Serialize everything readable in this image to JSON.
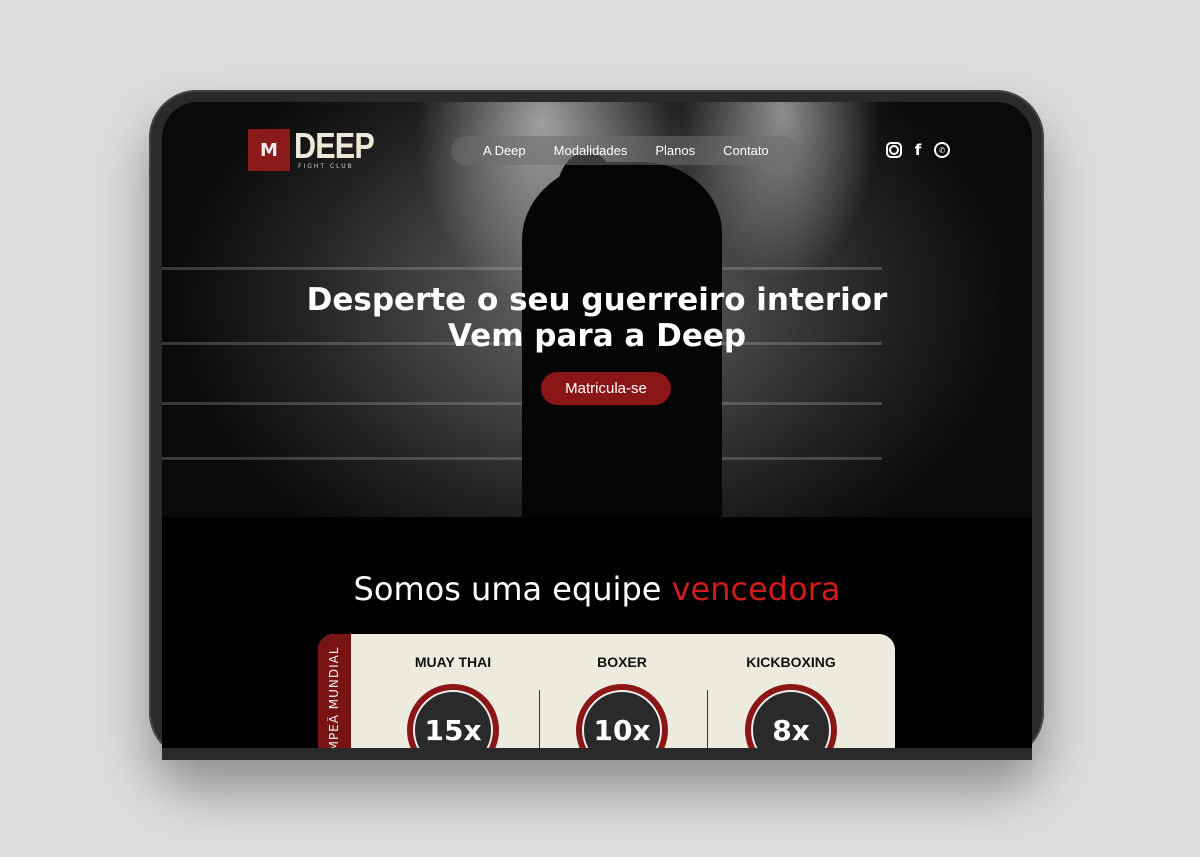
{
  "logo": {
    "mark": "M",
    "word": "DEEP",
    "sub": "FIGHT CLUB"
  },
  "nav": [
    "A Deep",
    "Modalidades",
    "Planos",
    "Contato"
  ],
  "social": [
    "instagram-icon",
    "facebook-icon",
    "whatsapp-icon"
  ],
  "hero": {
    "line1": "Desperte o seu guerreiro interior",
    "line2": "Vem para a Deep",
    "cta": "Matricula-se"
  },
  "section": {
    "title": "Somos uma equipe ",
    "accent": "vencedora"
  },
  "card": {
    "side": "CAMPEÃ MUNDIAL",
    "items": [
      {
        "label": "MUAY THAI",
        "value": "15x"
      },
      {
        "label": "BOXER",
        "value": "10x"
      },
      {
        "label": "KICKBOXING",
        "value": "8x"
      }
    ]
  },
  "colors": {
    "accent": "#d01c1c",
    "brand": "#8b1616",
    "card": "#ecebde"
  }
}
